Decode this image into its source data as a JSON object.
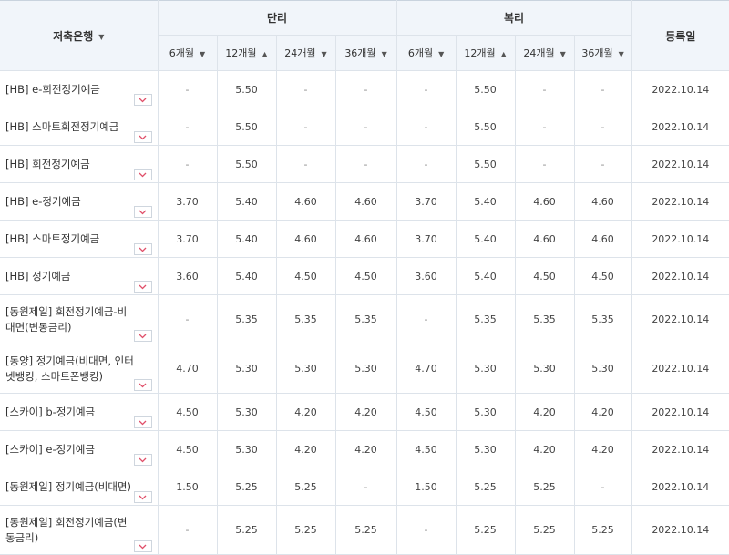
{
  "header": {
    "bank": "저축은행",
    "simple": "단리",
    "compound": "복리",
    "registered": "등록일",
    "terms": [
      {
        "label": "6개월",
        "sort": "▼"
      },
      {
        "label": "12개월",
        "sort": "▲"
      },
      {
        "label": "24개월",
        "sort": "▼"
      },
      {
        "label": "36개월",
        "sort": "▼"
      }
    ],
    "bank_sort": "▼"
  },
  "rows": [
    {
      "name": "[HB] e-회전정기예금",
      "simple": [
        "-",
        "5.50",
        "-",
        "-"
      ],
      "compound": [
        "-",
        "5.50",
        "-",
        "-"
      ],
      "date": "2022.10.14"
    },
    {
      "name": "[HB] 스마트회전정기예금",
      "simple": [
        "-",
        "5.50",
        "-",
        "-"
      ],
      "compound": [
        "-",
        "5.50",
        "-",
        "-"
      ],
      "date": "2022.10.14"
    },
    {
      "name": "[HB] 회전정기예금",
      "simple": [
        "-",
        "5.50",
        "-",
        "-"
      ],
      "compound": [
        "-",
        "5.50",
        "-",
        "-"
      ],
      "date": "2022.10.14"
    },
    {
      "name": "[HB] e-정기예금",
      "simple": [
        "3.70",
        "5.40",
        "4.60",
        "4.60"
      ],
      "compound": [
        "3.70",
        "5.40",
        "4.60",
        "4.60"
      ],
      "date": "2022.10.14"
    },
    {
      "name": "[HB] 스마트정기예금",
      "simple": [
        "3.70",
        "5.40",
        "4.60",
        "4.60"
      ],
      "compound": [
        "3.70",
        "5.40",
        "4.60",
        "4.60"
      ],
      "date": "2022.10.14"
    },
    {
      "name": "[HB] 정기예금",
      "simple": [
        "3.60",
        "5.40",
        "4.50",
        "4.50"
      ],
      "compound": [
        "3.60",
        "5.40",
        "4.50",
        "4.50"
      ],
      "date": "2022.10.14"
    },
    {
      "name": "[동원제일] 회전정기예금-비대면(변동금리)",
      "simple": [
        "-",
        "5.35",
        "5.35",
        "5.35"
      ],
      "compound": [
        "-",
        "5.35",
        "5.35",
        "5.35"
      ],
      "date": "2022.10.14"
    },
    {
      "name": "[동양] 정기예금(비대면, 인터넷뱅킹, 스마트폰뱅킹)",
      "simple": [
        "4.70",
        "5.30",
        "5.30",
        "5.30"
      ],
      "compound": [
        "4.70",
        "5.30",
        "5.30",
        "5.30"
      ],
      "date": "2022.10.14"
    },
    {
      "name": "[스카이] b-정기예금",
      "simple": [
        "4.50",
        "5.30",
        "4.20",
        "4.20"
      ],
      "compound": [
        "4.50",
        "5.30",
        "4.20",
        "4.20"
      ],
      "date": "2022.10.14"
    },
    {
      "name": "[스카이] e-정기예금",
      "simple": [
        "4.50",
        "5.30",
        "4.20",
        "4.20"
      ],
      "compound": [
        "4.50",
        "5.30",
        "4.20",
        "4.20"
      ],
      "date": "2022.10.14"
    },
    {
      "name": "[동원제일] 정기예금(비대면)",
      "simple": [
        "1.50",
        "5.25",
        "5.25",
        "-"
      ],
      "compound": [
        "1.50",
        "5.25",
        "5.25",
        "-"
      ],
      "date": "2022.10.14"
    },
    {
      "name": "[동원제일] 회전정기예금(변동금리)",
      "simple": [
        "-",
        "5.25",
        "5.25",
        "5.25"
      ],
      "compound": [
        "-",
        "5.25",
        "5.25",
        "5.25"
      ],
      "date": "2022.10.14"
    }
  ],
  "colors": {
    "header_bg": "#f1f5fa",
    "border": "#dde3ea",
    "toggle_arrow": "#e0506a"
  },
  "icons": {
    "expand": "chevron-down-icon"
  }
}
